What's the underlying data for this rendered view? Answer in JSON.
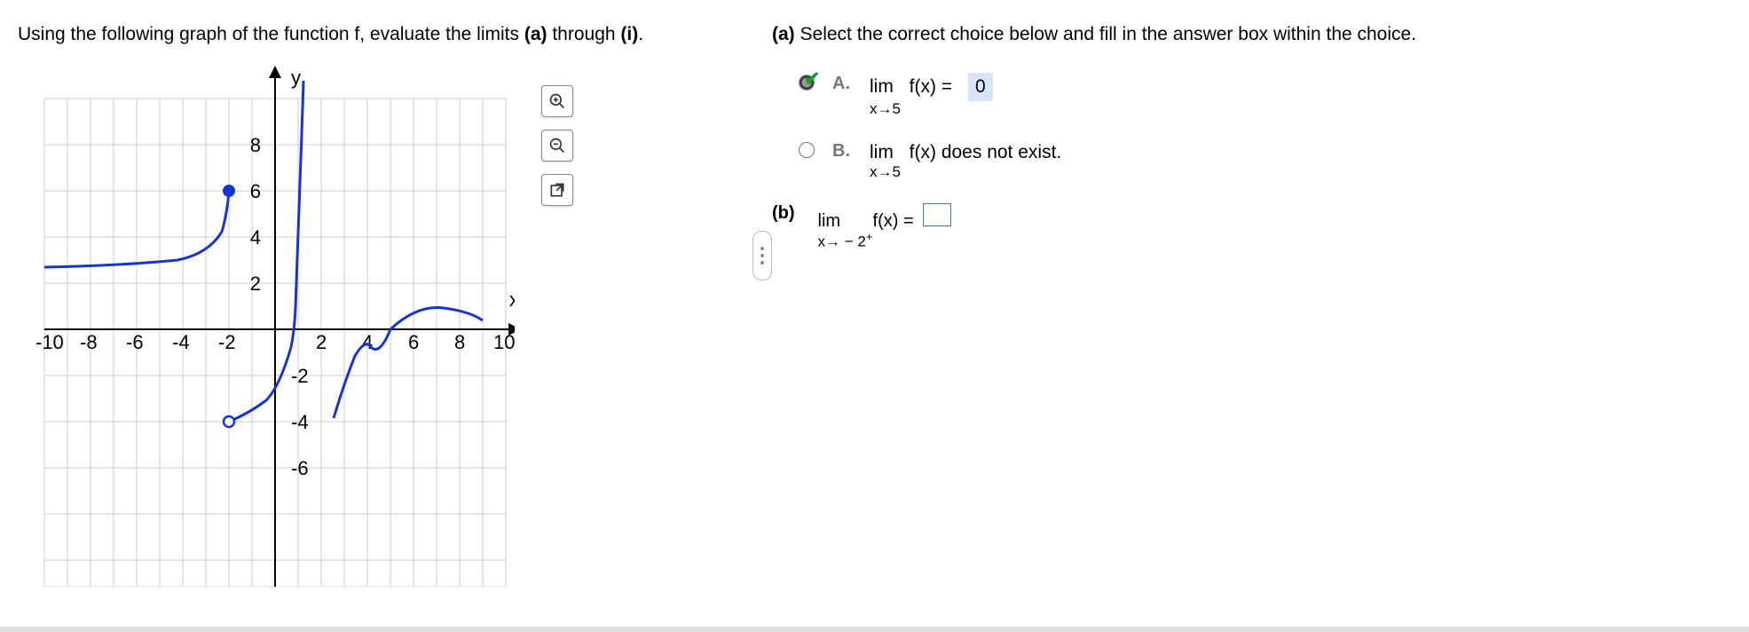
{
  "left": {
    "instruction_pre": "Using the following graph of the function f, evaluate the limits ",
    "instruction_bold1": "(a)",
    "instruction_mid": " through ",
    "instruction_bold2": "(i)",
    "instruction_post": "."
  },
  "tools": {
    "zoom_in": "zoom-in",
    "zoom_out": "zoom-out",
    "popout": "open-new"
  },
  "partA": {
    "label": "(a)",
    "prompt": " Select the correct choice below and fill in the answer box within the choice.",
    "choiceA": {
      "letter": "A.",
      "lim": "lim",
      "fx_eq": "f(x) =",
      "value": "0",
      "sub": "x→5",
      "selected": true
    },
    "choiceB": {
      "letter": "B.",
      "lim": "lim",
      "text": "f(x) does not exist.",
      "sub": "x→5",
      "selected": false
    }
  },
  "partB": {
    "label": "(b)",
    "lim": "lim",
    "fx_eq": "f(x) =",
    "sub": "x→ − 2",
    "sup": "+"
  },
  "chart_data": {
    "type": "line",
    "title": "",
    "xlabel": "x",
    "ylabel": "y",
    "xlim": [
      -10,
      10
    ],
    "ylim": [
      -7,
      8
    ],
    "xticks": [
      -10,
      -8,
      -6,
      -4,
      -2,
      2,
      4,
      6,
      8,
      10
    ],
    "yticks": [
      -6,
      -4,
      -2,
      2,
      4,
      6,
      8
    ],
    "grid": true,
    "series": [
      {
        "name": "f-left-branch",
        "x": [
          -10,
          -9,
          -8,
          -7,
          -6,
          -5,
          -4,
          -3,
          -2.5,
          -2.2,
          -2.05
        ],
        "y": [
          2.7,
          2.7,
          2.75,
          2.8,
          2.85,
          2.95,
          3.1,
          3.5,
          4.2,
          5.0,
          6.0
        ]
      },
      {
        "name": "f-middle-branch",
        "x": [
          -1.95,
          -1.8,
          -1.5,
          -1,
          0,
          0.5,
          0.9
        ],
        "y": [
          -4.0,
          -3.8,
          -3.6,
          -3.4,
          -3.0,
          -2.3,
          -0.2
        ]
      },
      {
        "name": "f-middle-up",
        "x": [
          0.9,
          1.0,
          1.1,
          1.2,
          1.3,
          1.4,
          1.5
        ],
        "y": [
          -0.2,
          2,
          4,
          6,
          8,
          10,
          12
        ]
      },
      {
        "name": "f-right-branch",
        "x": [
          2.5,
          2.8,
          3,
          3.5,
          4,
          4.5,
          5,
          6,
          7,
          8,
          9
        ],
        "y": [
          -3,
          -2.0,
          -1.4,
          -0.9,
          -0.5,
          -0.1,
          0,
          0.6,
          0.9,
          0.8,
          0.5
        ]
      }
    ],
    "markers": [
      {
        "x": -2,
        "y": 6,
        "type": "closed"
      },
      {
        "x": -2,
        "y": -4,
        "type": "open"
      }
    ],
    "asymptotes": []
  }
}
